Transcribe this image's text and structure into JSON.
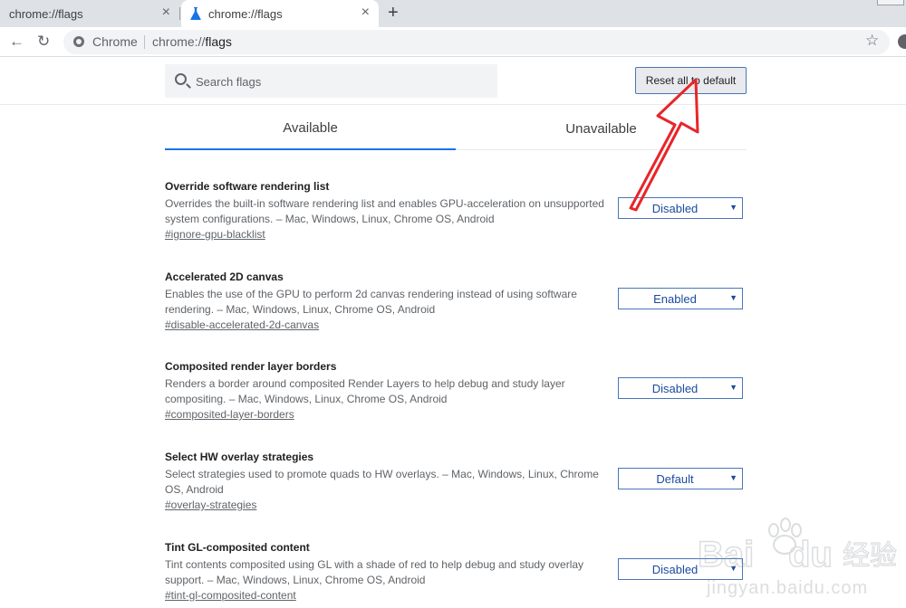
{
  "tabs": [
    {
      "title": "chrome://flags",
      "close": "×"
    },
    {
      "title": "chrome://flags",
      "close": "×"
    }
  ],
  "new_tab": "+",
  "toolbar": {
    "back": "←",
    "reload": "↻",
    "origin": "Chrome",
    "url_scheme": "chrome://",
    "url_host": "flags",
    "star": "☆"
  },
  "flags_header": {
    "search_placeholder": "Search flags",
    "reset_label": "Reset all to default"
  },
  "content_tabs": {
    "available": "Available",
    "unavailable": "Unavailable"
  },
  "experiments": [
    {
      "title": "Override software rendering list",
      "description": "Overrides the built-in software rendering list and enables GPU-acceleration on unsupported system configurations. – Mac, Windows, Linux, Chrome OS, Android",
      "link": "#ignore-gpu-blacklist",
      "value": "Disabled"
    },
    {
      "title": "Accelerated 2D canvas",
      "description": "Enables the use of the GPU to perform 2d canvas rendering instead of using software rendering. – Mac, Windows, Linux, Chrome OS, Android",
      "link": "#disable-accelerated-2d-canvas",
      "value": "Enabled"
    },
    {
      "title": "Composited render layer borders",
      "description": "Renders a border around composited Render Layers to help debug and study layer compositing. – Mac, Windows, Linux, Chrome OS, Android",
      "link": "#composited-layer-borders",
      "value": "Disabled"
    },
    {
      "title": "Select HW overlay strategies",
      "description": "Select strategies used to promote quads to HW overlays. – Mac, Windows, Linux, Chrome OS, Android",
      "link": "#overlay-strategies",
      "value": "Default"
    },
    {
      "title": "Tint GL-composited content",
      "description": "Tint contents composited using GL with a shade of red to help debug and study overlay support. – Mac, Windows, Linux, Chrome OS, Android",
      "link": "#tint-gl-composited-content",
      "value": "Disabled"
    }
  ],
  "select_arrow": "▼",
  "colors": {
    "accent": "#1a73e8",
    "annotation": "#e8252a",
    "select_border": "#4a76b8"
  },
  "watermark": {
    "brand": "Bai du 经验",
    "url": "jingyan.baidu.com"
  }
}
